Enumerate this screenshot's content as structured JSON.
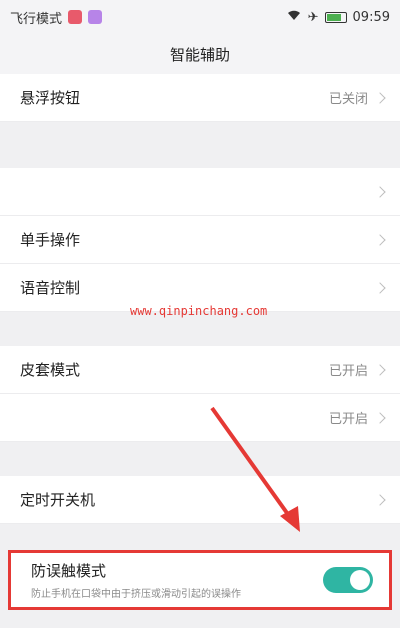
{
  "statusbar": {
    "carrier": "飞行模式",
    "time": "09:59"
  },
  "header": {
    "title": "智能辅助"
  },
  "rows": [
    {
      "label": "悬浮按钮",
      "status": "已关闭"
    },
    {
      "label": "",
      "status": ""
    },
    {
      "label": "单手操作",
      "status": ""
    },
    {
      "label": "语音控制",
      "status": ""
    },
    {
      "label": "皮套模式",
      "status": "已开启"
    },
    {
      "label": "",
      "status": "已开启"
    },
    {
      "label": "定时开关机",
      "status": ""
    }
  ],
  "watermark": "www.qinpinchang.com",
  "highlight": {
    "title": "防误触模式",
    "subtitle": "防止手机在口袋中由于挤压或滑动引起的误操作",
    "toggle_on": true,
    "accent": "#2fb5a3",
    "box_color": "#e53935"
  }
}
